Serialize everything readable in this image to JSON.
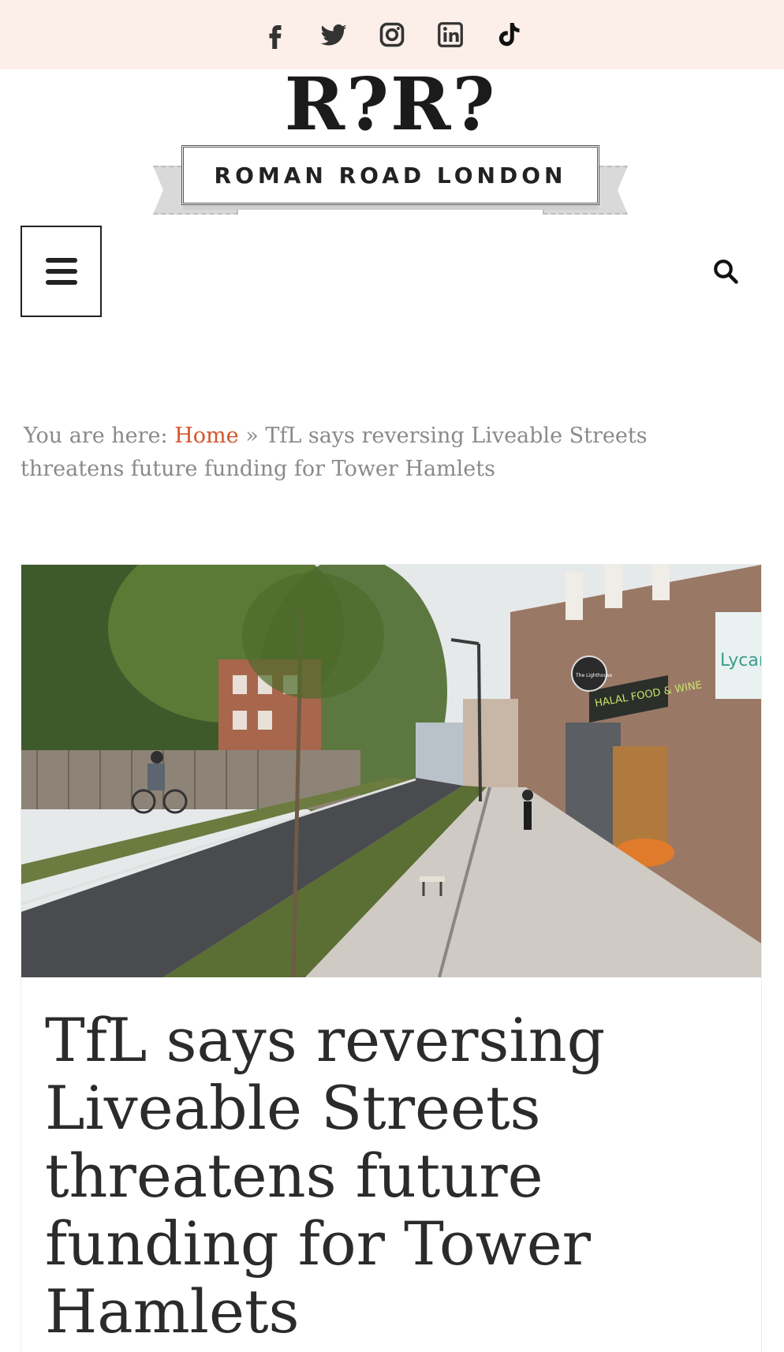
{
  "social": {
    "items": [
      {
        "name": "facebook-icon"
      },
      {
        "name": "twitter-icon"
      },
      {
        "name": "instagram-icon"
      },
      {
        "name": "linkedin-icon"
      },
      {
        "name": "tiktok-icon"
      }
    ]
  },
  "logo": {
    "mark": "R?R?",
    "tagline": "ROMAN ROAD LONDON"
  },
  "nav": {
    "menu_icon": "hamburger-menu-icon",
    "search_icon": "search-icon"
  },
  "breadcrumb": {
    "prefix": "You are here:",
    "home": "Home",
    "separator": "»",
    "current": "TfL says reversing Liveable Streets threatens future funding for Tower Hamlets"
  },
  "article": {
    "hero_signs": {
      "shop_sign": "HALAL FOOD & WINE",
      "round_sign": "The Lighthouse",
      "side_sign": "Lycar"
    },
    "title": "TfL says reversing Liveable Streets threatens future funding for Tower Hamlets"
  },
  "colors": {
    "social_bar_bg": "#fcefe9",
    "breadcrumb_link": "#d2572a",
    "breadcrumb_text": "#8a8a8a",
    "headline_text": "#2b2b2b"
  }
}
